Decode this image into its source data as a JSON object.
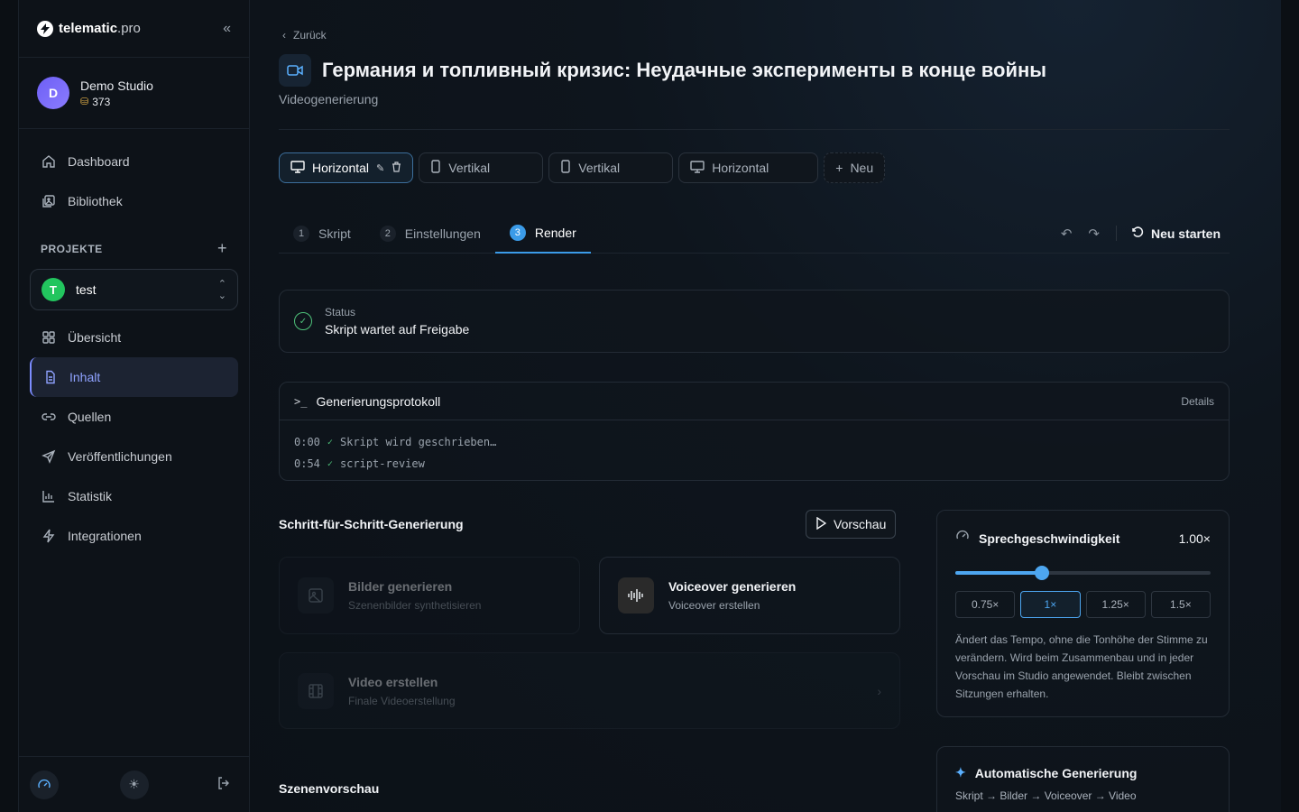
{
  "sidebar": {
    "brand": "telematic",
    "brand_suffix": ".pro",
    "studio_initial": "D",
    "studio_name": "Demo Studio",
    "credits": "373",
    "nav_top": [
      {
        "label": "Dashboard",
        "icon": "home-icon"
      },
      {
        "label": "Bibliothek",
        "icon": "library-icon"
      }
    ],
    "projects_label": "PROJEKTE",
    "project": {
      "initial": "T",
      "name": "test",
      "color": "#22c55e"
    },
    "nav_project": [
      {
        "label": "Übersicht",
        "icon": "grid-icon"
      },
      {
        "label": "Inhalt",
        "icon": "document-icon",
        "active": true
      },
      {
        "label": "Quellen",
        "icon": "link-icon"
      },
      {
        "label": "Veröffentlichungen",
        "icon": "send-icon"
      },
      {
        "label": "Statistik",
        "icon": "chart-icon"
      },
      {
        "label": "Integrationen",
        "icon": "zap-icon"
      }
    ]
  },
  "header": {
    "back_label": "Zurück",
    "title": "Германия и топливный кризис: Неудачные эксперименты в конце войны",
    "subtitle": "Videogenerierung"
  },
  "formats": [
    {
      "label": "Horizontal",
      "icon": "monitor-icon",
      "active": true
    },
    {
      "label": "Vertikal",
      "icon": "phone-icon"
    },
    {
      "label": "Vertikal",
      "icon": "phone-icon"
    },
    {
      "label": "Horizontal",
      "icon": "monitor-icon"
    },
    {
      "label": "Neu",
      "icon": "plus-icon"
    }
  ],
  "steps": [
    {
      "num": "1",
      "label": "Skript"
    },
    {
      "num": "2",
      "label": "Einstellungen"
    },
    {
      "num": "3",
      "label": "Render",
      "active": true
    }
  ],
  "restart_label": "Neu starten",
  "status": {
    "label": "Status",
    "value": "Skript wartet auf Freigabe"
  },
  "log": {
    "title": "Generierungsprotokoll",
    "details": "Details",
    "prompt": ">_",
    "lines": [
      {
        "time": "0:00",
        "text": "Skript wird geschrieben…"
      },
      {
        "time": "0:54",
        "text": "script-review"
      }
    ]
  },
  "stepwise": {
    "title": "Schritt-für-Schritt-Generierung",
    "preview_label": "Vorschau",
    "images": {
      "title": "Bilder generieren",
      "sub": "Szenenbilder synthetisieren"
    },
    "voice": {
      "title": "Voiceover generieren",
      "sub": "Voiceover erstellen"
    },
    "video": {
      "title": "Video erstellen",
      "sub": "Finale Videoerstellung"
    }
  },
  "scene_preview_title": "Szenenvorschau",
  "speed": {
    "title": "Sprechgeschwindigkeit",
    "value": "1.00×",
    "level": 0.34,
    "options": [
      "0.75×",
      "1×",
      "1.25×",
      "1.5×"
    ],
    "selected": "1×",
    "description": "Ändert das Tempo, ohne die Tonhöhe der Stimme zu verändern. Wird beim Zusammenbau und in jeder Vorschau im Studio angewendet. Bleibt zwischen Sitzungen erhalten."
  },
  "auto": {
    "title": "Automatische Generierung",
    "sub": "Skript → Bilder → Voiceover → Video"
  },
  "colors": {
    "accent": "#4da6f0",
    "active_nav": "#8fa2ff",
    "success": "#4ec27a"
  }
}
